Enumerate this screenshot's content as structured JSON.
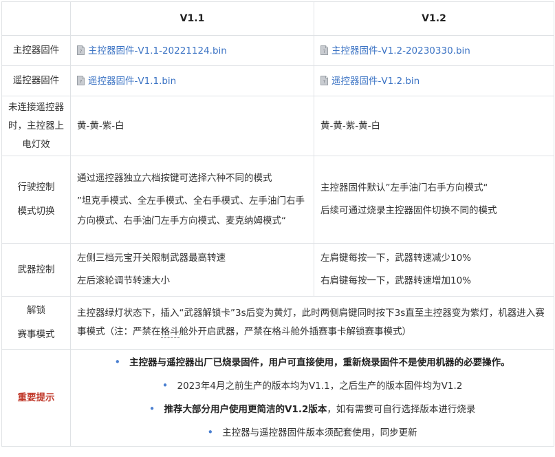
{
  "header": {
    "col_label": "",
    "v1_1": "V1.1",
    "v1_2": "V1.2"
  },
  "rows": {
    "main_fw": {
      "label": "主控器固件",
      "v1_1": "主控器固件-V1.1-20221124.bin",
      "v1_2": "主控器固件-V1.2-20230330.bin"
    },
    "remote_fw": {
      "label": "遥控器固件",
      "v1_1": "遥控器固件-V1.1.bin",
      "v1_2": "遥控器固件-V1.2.bin"
    },
    "led": {
      "label": "未连接遥控器时，主控器上电灯效",
      "v1_1": "黄-黄-紫-白",
      "v1_2": "黄-黄-紫-黄-白"
    },
    "mode": {
      "label_line1": "行驶控制",
      "label_line2": "模式切换",
      "v1_1_p1": "通过遥控器独立六档按键可选择六种不同的模式",
      "v1_1_p2": "”坦克手模式、全左手模式、全右手模式、左手油门右手方向模式、右手油门左手方向模式、麦克纳姆模式“",
      "v1_2_p1": "主控器固件默认”左手油门右手方向模式“",
      "v1_2_p2": "后续可通过烧录主控器固件切换不同的模式"
    },
    "weapon": {
      "label": "武器控制",
      "v1_1_p1": "左侧三档元宝开关限制武器最高转速",
      "v1_1_p2": "左后滚轮调节转速大小",
      "v1_2_p1": "左肩键每按一下，武器转速减少10%",
      "v1_2_p2": "右肩键每按一下，武器转速增加10%"
    },
    "unlock": {
      "label_line1": "解锁",
      "label_line2": "赛事模式",
      "text_before": "主控器绿灯状态下，插入“武器解锁卡”3s后变为黄灯，此时两侧肩键同时按下3s直至主控器变为紫灯，机器进入赛事模式（注：严禁在",
      "text_dotted": "格斗",
      "text_after": "舱外开启武器，严禁在格斗舱外插赛事卡解锁赛事模式）"
    },
    "notes": {
      "label": "重要提示",
      "item1": "主控器与遥控器出厂已烧录固件，用户可直接使用，重新烧录固件不是使用机器的必要操作。",
      "item2": "2023年4月之前生产的版本均为V1.1，之后生产的版本固件均为V1.2",
      "item3_bold": "推荐大部分用户使用更简洁的V1.2版本",
      "item3_rest": "，如有需要可自行选择版本进行烧录",
      "item4": "主控器与遥控器固件版本须配套使用，同步更新"
    }
  },
  "icons": {
    "file": "file-icon"
  },
  "colors": {
    "link": "#3b73c4",
    "notes_heading": "#c0392b",
    "bullet": "#4a7fd0",
    "border": "#dfe2e5"
  }
}
